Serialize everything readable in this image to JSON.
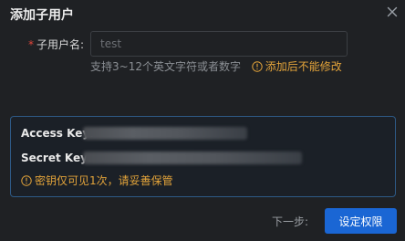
{
  "dialog": {
    "title": "添加子用户",
    "close_icon": "close-icon"
  },
  "form": {
    "required_mark": "*",
    "username_label": "子用户名:",
    "username_placeholder": "test",
    "username_hint": "支持3~12个英文字符或者数字",
    "username_warning": "添加后不能修改",
    "warning_icon": "info-circle-icon"
  },
  "keys": {
    "access_key_label": "Access Key:",
    "secret_key_label": "Secret Key:",
    "note": "密钥仅可见1次，请妥善保管",
    "note_icon": "info-circle-icon"
  },
  "footer": {
    "next_step_label": "下一步:",
    "set_permission_button": "设定权限"
  },
  "colors": {
    "background": "#1f2124",
    "primary": "#1a66d4",
    "warning": "#e2a33a",
    "required": "#e0453a",
    "panel_border": "#2e5a86"
  }
}
